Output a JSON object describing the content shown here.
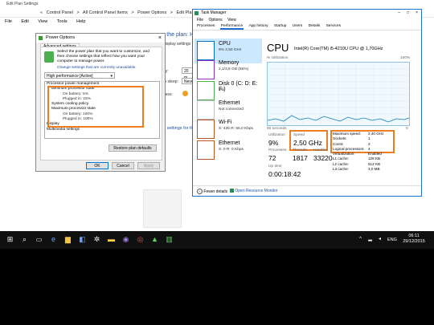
{
  "edit_plan": {
    "title": "Edit Plan Settings",
    "breadcrumbs": [
      "«",
      "Control Panel",
      ">",
      "All Control Panel Items",
      ">",
      "Power Options",
      ">",
      "Edit Plan Settings"
    ],
    "menu": [
      "File",
      "Edit",
      "View",
      "Tools",
      "Help"
    ],
    "heading": "r the plan: H",
    "line1": "display settings t",
    "row_display": "ay:",
    "row_sleep": "to sleep:",
    "dropdown1": "20 m",
    "dropdown2": "Neve",
    "brightness": "ness:",
    "bottom_text": "e settings for this plan"
  },
  "power_options": {
    "title": "Power Options",
    "tab": "Advanced settings",
    "desc": "Select the power plan that you want to customize, and then choose settings that reflect how you want your computer to manage power.",
    "link": "Change settings that are currently unavailable",
    "plan": "High performance [Active]",
    "tree": [
      "Processor power management",
      "Minimum processor state",
      "On battery: 5%",
      "Plugged in: 15%",
      "System cooling policy",
      "Maximum processor state",
      "On battery: 100%",
      "Plugged in: 100%",
      "Display",
      "Multimedia settings"
    ],
    "restore_btn": "Restore plan defaults",
    "ok": "OK",
    "cancel": "Cancel",
    "apply": "Apply"
  },
  "task_manager": {
    "title": "Task Manager",
    "menu": [
      "File",
      "Options",
      "View"
    ],
    "tabs": [
      "Processes",
      "Performance",
      "App history",
      "Startup",
      "Users",
      "Details",
      "Services"
    ],
    "sidebar": [
      {
        "name": "CPU",
        "sub": "8% 2,50 GHz"
      },
      {
        "name": "Memory",
        "sub": "2,1/3,8 GB (55%)"
      },
      {
        "name": "Disk 0 (C: D: E: F:)",
        "sub": "4%"
      },
      {
        "name": "Ethernet",
        "sub": "Not connected"
      },
      {
        "name": "Wi-Fi",
        "sub": "S: 436 R: 56,0 Kbps"
      },
      {
        "name": "Ethernet",
        "sub": "S: 0 R: 0 Kbps"
      }
    ],
    "cpu_heading": "CPU",
    "cpu_model": "Intel(R) Core(TM) i5-4210U CPU @ 1,70GHz",
    "utilization_label": "% Utilization",
    "pct_top": "100%",
    "seconds": "60 seconds",
    "zero": "0",
    "utilization": {
      "label": "Utilization",
      "value": "9%"
    },
    "speed": {
      "label": "Speed",
      "value": "2,50 GHz"
    },
    "processes": {
      "label": "Processes",
      "value": "72"
    },
    "threads": {
      "label": "Threads",
      "value": "1817"
    },
    "handles": {
      "label": "Handles",
      "value": "33220"
    },
    "uptime": {
      "label": "Up time",
      "value": "0:00:18:42"
    },
    "specs": [
      {
        "k": "Maximum speed:",
        "v": "2,40 GHz"
      },
      {
        "k": "Sockets:",
        "v": "1"
      },
      {
        "k": "Cores:",
        "v": "2"
      },
      {
        "k": "Logical processors:",
        "v": "4"
      },
      {
        "k": "Virtualization:",
        "v": "Enabled"
      },
      {
        "k": "L1 cache:",
        "v": "128 KB"
      },
      {
        "k": "L2 cache:",
        "v": "512 KB"
      },
      {
        "k": "L3 cache:",
        "v": "3,0 MB"
      }
    ],
    "fewer_details": "Fewer details",
    "open_monitor": "Open Resource Monitor"
  },
  "taskbar": {
    "lang": "ENG",
    "time": "06:11",
    "date": "29/12/2015"
  },
  "colors": {
    "accent": "#1e6fd0",
    "highlight": "#ec7d22",
    "taskbar": "#101010"
  }
}
